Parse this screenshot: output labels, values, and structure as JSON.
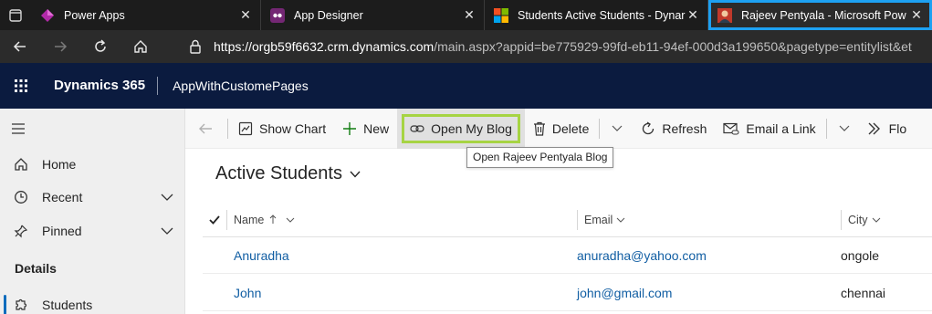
{
  "browser": {
    "tabs": [
      {
        "title": "Power Apps",
        "icon": "power-apps-icon"
      },
      {
        "title": "App Designer",
        "icon": "app-designer-icon"
      },
      {
        "title": "Students Active Students - Dynar",
        "icon": "microsoft-logo-icon"
      },
      {
        "title": "Rajeev Pentyala - Microsoft Pow",
        "icon": "avatar-icon"
      }
    ],
    "url_host": "https://orgb59f6632.crm.dynamics.com",
    "url_path": "/main.aspx?appid=be775929-99fd-eb11-94ef-000d3a199650&pagetype=entitylist&et"
  },
  "header": {
    "brand": "Dynamics 365",
    "app_name": "AppWithCustomePages"
  },
  "nav": {
    "items": [
      {
        "label": "Home",
        "icon": "home-icon"
      },
      {
        "label": "Recent",
        "icon": "clock-icon"
      },
      {
        "label": "Pinned",
        "icon": "pin-icon"
      }
    ],
    "section": "Details",
    "entity": "Students"
  },
  "commands": {
    "show_chart": "Show Chart",
    "new": "New",
    "open_blog": "Open My Blog",
    "delete": "Delete",
    "refresh": "Refresh",
    "email_link": "Email a Link",
    "flow": "Flo"
  },
  "tooltip": "Open Rajeev Pentyala Blog",
  "view": {
    "title": "Active Students"
  },
  "grid": {
    "columns": [
      "Name",
      "Email",
      "City"
    ],
    "rows": [
      {
        "name": "Anuradha",
        "email": "anuradha@yahoo.com",
        "city": "ongole"
      },
      {
        "name": "John",
        "email": "john@gmail.com",
        "city": "chennai"
      }
    ]
  },
  "colors": {
    "header_bg": "#0b1b3f",
    "link": "#115ea3",
    "highlight_border": "#a6d443",
    "active_tab_outline": "#1da1f2"
  }
}
